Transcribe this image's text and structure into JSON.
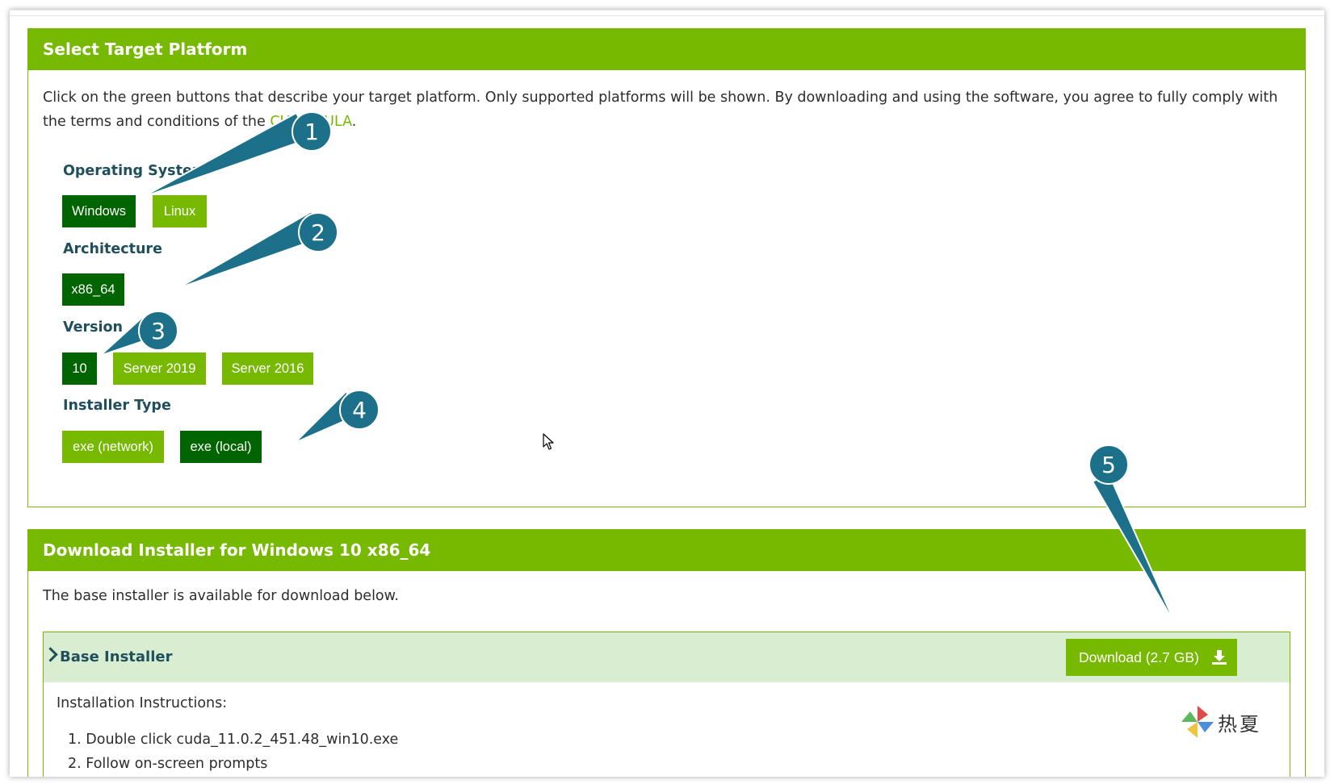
{
  "platform_panel": {
    "title": "Select Target Platform",
    "intro": "Click on the green buttons that describe your target platform. Only supported platforms will be shown. By downloading and using the software, you agree to fully comply with the terms and conditions of the",
    "eula_link": "CUDA EULA",
    "intro_end": "."
  },
  "os": {
    "label": "Operating System",
    "options": [
      {
        "label": "Windows",
        "selected": true
      },
      {
        "label": "Linux",
        "selected": false
      }
    ]
  },
  "arch": {
    "label": "Architecture",
    "options": [
      {
        "label": "x86_64",
        "selected": true
      }
    ]
  },
  "version": {
    "label": "Version",
    "options": [
      {
        "label": "10",
        "selected": true
      },
      {
        "label": "Server 2019",
        "selected": false
      },
      {
        "label": "Server 2016",
        "selected": false
      }
    ]
  },
  "installer_type": {
    "label": "Installer Type",
    "options": [
      {
        "label": "exe (network)",
        "selected": false
      },
      {
        "label": "exe (local)",
        "selected": true
      }
    ]
  },
  "download_panel": {
    "title": "Download Installer for Windows 10 x86_64",
    "description": "The base installer is available for download below.",
    "base_installer": {
      "title": "Base Installer",
      "download_label": "Download (2.7 GB)",
      "instructions_title": "Installation Instructions:",
      "steps": [
        "1. Double click cuda_11.0.2_451.48_win10.exe",
        "2. Follow on-screen prompts"
      ]
    }
  },
  "callouts": [
    "1",
    "2",
    "3",
    "4",
    "5"
  ],
  "watermark": "热夏",
  "colors": {
    "accent_green": "#76b900",
    "selected_green": "#006400",
    "callout_blue": "#1d7089",
    "label_text": "#1f4f5c",
    "installer_bg": "#d9eed1"
  }
}
